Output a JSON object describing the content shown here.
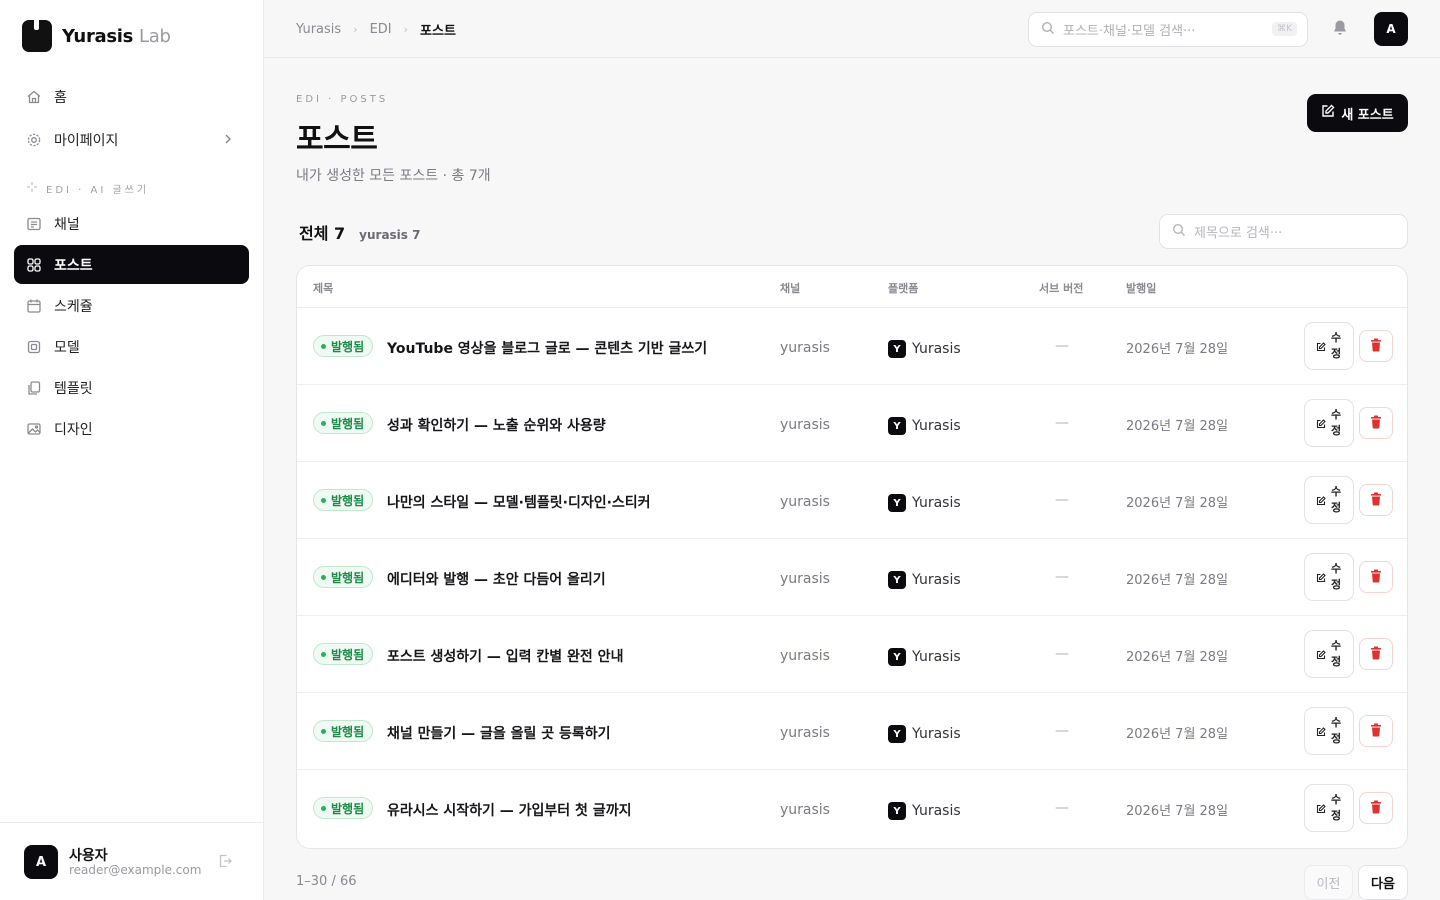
{
  "brand": {
    "name": "Yurasis",
    "suffix": "Lab"
  },
  "sidebar": {
    "items_top": [
      {
        "label": "홈",
        "icon": "home-icon"
      },
      {
        "label": "마이페이지",
        "icon": "gear-icon"
      }
    ],
    "section_label": "EDI · AI 글쓰기",
    "items": [
      {
        "label": "채널",
        "icon": "channel-icon"
      },
      {
        "label": "포스트",
        "icon": "grid-icon",
        "active": true
      },
      {
        "label": "스케쥴",
        "icon": "calendar-icon"
      },
      {
        "label": "모델",
        "icon": "model-icon"
      },
      {
        "label": "템플릿",
        "icon": "template-icon"
      },
      {
        "label": "디자인",
        "icon": "image-icon"
      }
    ]
  },
  "user": {
    "initial": "A",
    "name": "사용자",
    "email": "reader@example.com"
  },
  "topbar": {
    "breadcrumbs": [
      "Yurasis",
      "EDI",
      "포스트"
    ],
    "search_placeholder": "포스트·채널·모델 검색···",
    "shortcut": "⌘K",
    "avatar": "A"
  },
  "header": {
    "eyebrow": "EDI · POSTS",
    "title": "포스트",
    "subtitle": "내가 생성한 모든 포스트 · 총 7개",
    "new_button": "새 포스트"
  },
  "filters": {
    "all": "전체 7",
    "tag": "yurasis 7",
    "search_placeholder": "제목으로 검색···"
  },
  "table": {
    "columns": [
      "제목",
      "채널",
      "플랫폼",
      "서브 버전",
      "발행일"
    ],
    "status_label": "발행됨",
    "edit_label": "수정",
    "rows": [
      {
        "title": "YouTube 영상을 블로그 글로 — 콘텐츠 기반 글쓰기",
        "channel": "yurasis",
        "platform": "Yurasis",
        "platform_initial": "Y",
        "sub": "—",
        "date": "2026년 7월 28일"
      },
      {
        "title": "성과 확인하기 — 노출 순위와 사용량",
        "channel": "yurasis",
        "platform": "Yurasis",
        "platform_initial": "Y",
        "sub": "—",
        "date": "2026년 7월 28일"
      },
      {
        "title": "나만의 스타일 — 모델·템플릿·디자인·스티커",
        "channel": "yurasis",
        "platform": "Yurasis",
        "platform_initial": "Y",
        "sub": "—",
        "date": "2026년 7월 28일"
      },
      {
        "title": "에디터와 발행 — 초안 다듬어 올리기",
        "channel": "yurasis",
        "platform": "Yurasis",
        "platform_initial": "Y",
        "sub": "—",
        "date": "2026년 7월 28일"
      },
      {
        "title": "포스트 생성하기 — 입력 칸별 완전 안내",
        "channel": "yurasis",
        "platform": "Yurasis",
        "platform_initial": "Y",
        "sub": "—",
        "date": "2026년 7월 28일"
      },
      {
        "title": "채널 만들기 — 글을 올릴 곳 등록하기",
        "channel": "yurasis",
        "platform": "Yurasis",
        "platform_initial": "Y",
        "sub": "—",
        "date": "2026년 7월 28일"
      },
      {
        "title": "유라시스 시작하기 — 가입부터 첫 글까지",
        "channel": "yurasis",
        "platform": "Yurasis",
        "platform_initial": "Y",
        "sub": "—",
        "date": "2026년 7월 28일"
      }
    ]
  },
  "pagination": {
    "info": "1–30 / 66",
    "prev": "이전",
    "next": "다음"
  },
  "colors": {
    "primary": "#0b0b0f",
    "success": "#22b35c",
    "danger": "#e03131"
  }
}
